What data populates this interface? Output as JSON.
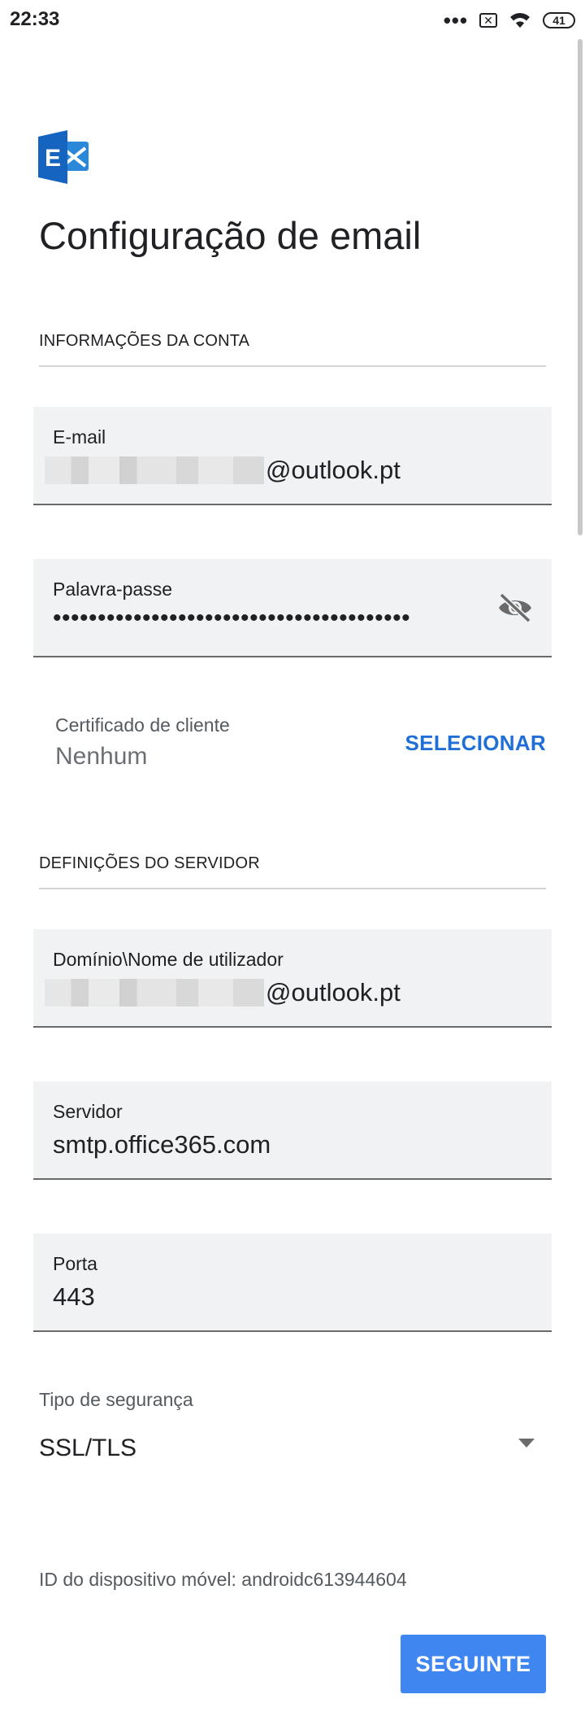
{
  "status_bar": {
    "time": "22:33",
    "overflow_dots": "•••",
    "sim_symbol": "✕",
    "battery_level": "41"
  },
  "header": {
    "title": "Configuração de email",
    "logo_icon": "exchange-logo-icon",
    "logo_letter": "E"
  },
  "account_section": {
    "heading": "INFORMAÇÕES DA CONTA",
    "email": {
      "label": "E-mail",
      "value_suffix": "@outlook.pt"
    },
    "password": {
      "label": "Palavra-passe",
      "value": "••••••••••••••••••••••••••••••••••••••••",
      "toggle_icon": "eye-off-icon"
    },
    "certificate": {
      "label": "Certificado de cliente",
      "value": "Nenhum",
      "action": "SELECIONAR"
    }
  },
  "server_section": {
    "heading": "DEFINIÇÕES DO SERVIDOR",
    "domain_user": {
      "label": "Domínio\\Nome de utilizador",
      "value_suffix": "@outlook.pt"
    },
    "server": {
      "label": "Servidor",
      "value": "smtp.office365.com"
    },
    "port": {
      "label": "Porta",
      "value": "443"
    },
    "security": {
      "label": "Tipo de segurança",
      "value": "SSL/TLS"
    }
  },
  "device_id": "ID do dispositivo móvel: androidc613944604",
  "next_button": "SEGUINTE",
  "colors": {
    "accent": "#1f6fd6",
    "button": "#3f86f0",
    "field_bg": "#f1f2f4",
    "logo": "#1565c0"
  }
}
